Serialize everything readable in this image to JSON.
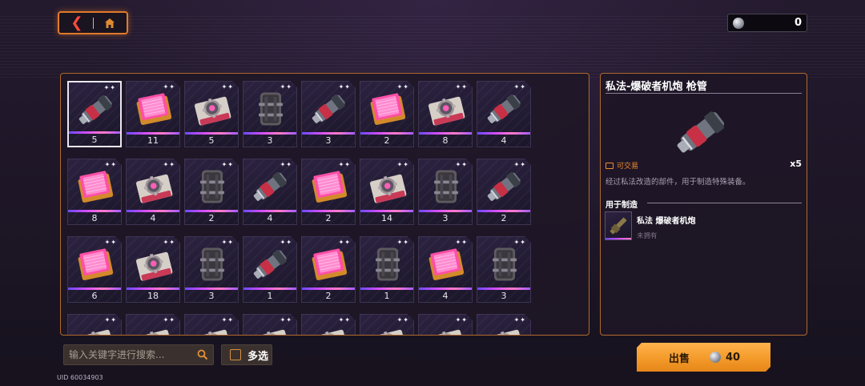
{
  "nav": {
    "back_icon": "back-arrow-icon",
    "home_icon": "home-icon"
  },
  "currency": {
    "icon": "silver-coin-icon",
    "amount": "0"
  },
  "inventory": {
    "items": [
      {
        "kind": "barrel",
        "qty": "5",
        "selected": true
      },
      {
        "kind": "pink-chip",
        "qty": "11"
      },
      {
        "kind": "gear-case",
        "qty": "5"
      },
      {
        "kind": "canister",
        "qty": "3"
      },
      {
        "kind": "barrel",
        "qty": "3"
      },
      {
        "kind": "pink-chip",
        "qty": "2"
      },
      {
        "kind": "gear-case",
        "qty": "8"
      },
      {
        "kind": "barrel",
        "qty": "4"
      },
      {
        "kind": "pink-chip",
        "qty": "8"
      },
      {
        "kind": "gear-case",
        "qty": "4"
      },
      {
        "kind": "canister",
        "qty": "2"
      },
      {
        "kind": "barrel",
        "qty": "4"
      },
      {
        "kind": "pink-chip",
        "qty": "2"
      },
      {
        "kind": "gear-case",
        "qty": "14"
      },
      {
        "kind": "canister",
        "qty": "3"
      },
      {
        "kind": "barrel",
        "qty": "2"
      },
      {
        "kind": "pink-chip",
        "qty": "6"
      },
      {
        "kind": "gear-case",
        "qty": "18"
      },
      {
        "kind": "canister",
        "qty": "3"
      },
      {
        "kind": "barrel",
        "qty": "1"
      },
      {
        "kind": "pink-chip",
        "qty": "2"
      },
      {
        "kind": "canister",
        "qty": "1"
      },
      {
        "kind": "pink-chip",
        "qty": "4"
      },
      {
        "kind": "canister",
        "qty": "3"
      },
      {
        "kind": "gear-case",
        "qty": ""
      },
      {
        "kind": "gear-case",
        "qty": ""
      },
      {
        "kind": "gear-case",
        "qty": ""
      },
      {
        "kind": "gear-case",
        "qty": ""
      },
      {
        "kind": "gear-case",
        "qty": ""
      },
      {
        "kind": "gear-case",
        "qty": ""
      },
      {
        "kind": "gear-case",
        "qty": ""
      },
      {
        "kind": "gear-case",
        "qty": ""
      }
    ]
  },
  "detail": {
    "title": "私法-爆破者机炮 枪管",
    "tradable_label": "可交易",
    "count": "x5",
    "description": "经过私法改造的部件，用于制造特殊装备。",
    "used_for_label": "用于制造",
    "craft_item": {
      "name": "私法 爆破者机炮",
      "status": "未拥有"
    }
  },
  "search": {
    "placeholder": "输入关键字进行搜索..."
  },
  "multi_select": {
    "label": "多选"
  },
  "uid": "UID 60034903",
  "sell": {
    "label": "出售",
    "price": "40"
  }
}
